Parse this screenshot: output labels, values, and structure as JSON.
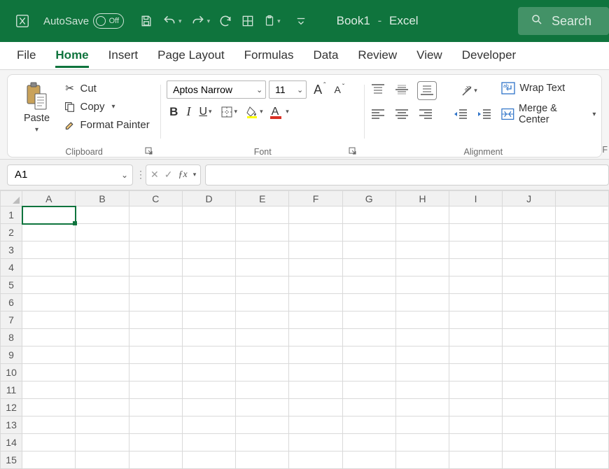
{
  "title": {
    "autosave": "AutoSave",
    "off": "Off",
    "doc": "Book1",
    "app": "Excel",
    "search": "Search"
  },
  "tabs": [
    "File",
    "Home",
    "Insert",
    "Page Layout",
    "Formulas",
    "Data",
    "Review",
    "View",
    "Developer"
  ],
  "active_tab": "Home",
  "ribbon": {
    "clipboard": {
      "paste": "Paste",
      "cut": "Cut",
      "copy": "Copy",
      "fmt": "Format Painter",
      "label": "Clipboard"
    },
    "font": {
      "name": "Aptos Narrow",
      "size": "11",
      "label": "Font"
    },
    "alignment": {
      "wrap": "Wrap Text",
      "merge": "Merge & Center",
      "label": "Alignment"
    },
    "edge": "F"
  },
  "fx": {
    "name": "A1"
  },
  "columns": [
    "A",
    "B",
    "C",
    "D",
    "E",
    "F",
    "G",
    "H",
    "I",
    "J"
  ],
  "rows": [
    "1",
    "2",
    "3",
    "4",
    "5",
    "6",
    "7",
    "8",
    "9",
    "10",
    "11",
    "12",
    "13",
    "14",
    "15"
  ],
  "active_cell": "A1"
}
